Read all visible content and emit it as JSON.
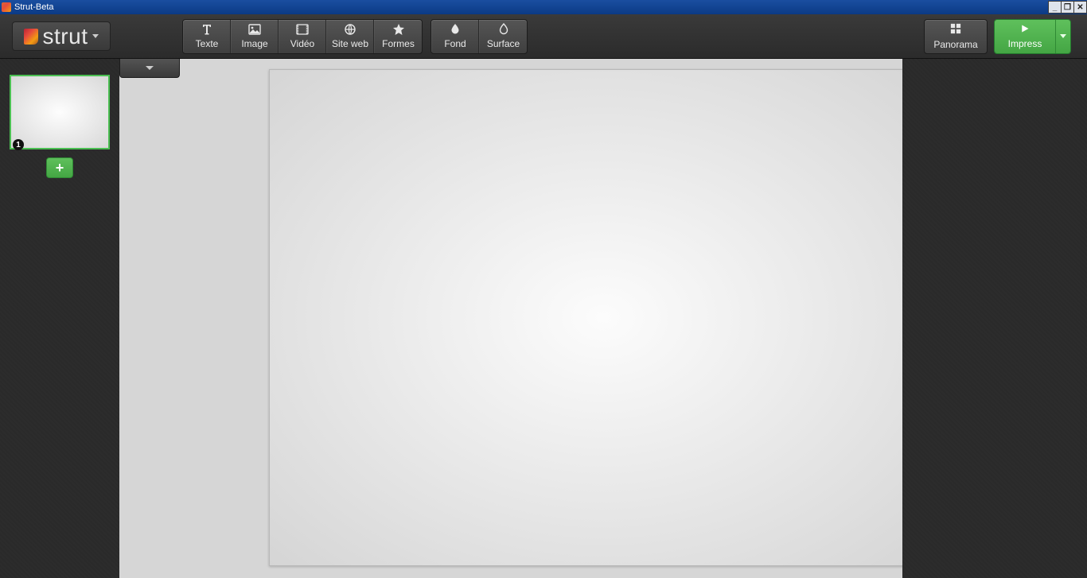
{
  "window": {
    "title": "Strut-Beta"
  },
  "brand": {
    "name": "strut"
  },
  "toolbar": {
    "insert": {
      "text": "Texte",
      "image": "Image",
      "video": "Vidéo",
      "web": "Site web",
      "shapes": "Formes"
    },
    "background": {
      "slide_bg": "Fond",
      "surface_bg": "Surface"
    }
  },
  "right": {
    "panorama": "Panorama",
    "impress": "Impress"
  },
  "slides": {
    "items": [
      {
        "number": "1"
      }
    ],
    "add_symbol": "+"
  },
  "winctrls": {
    "min": "_",
    "max": "❐",
    "close": "✕"
  }
}
